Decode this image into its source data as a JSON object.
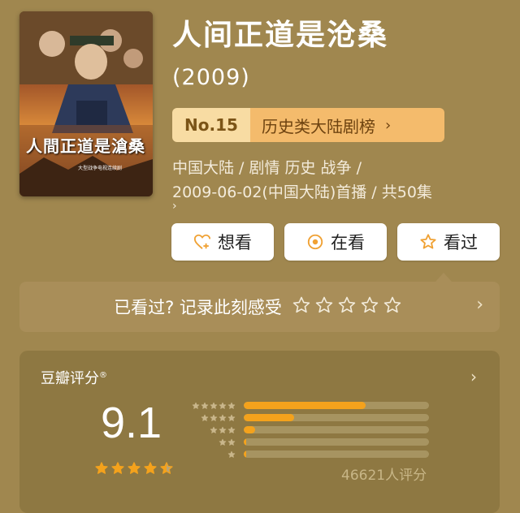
{
  "movie": {
    "title": "人间正道是沧桑",
    "year": "(2009)",
    "poster_title": "人間正道是滄桑",
    "poster_subtitle": "大型战争电视连续剧"
  },
  "rank": {
    "number": "No.15",
    "list_name": "历史类大陆剧榜"
  },
  "meta": {
    "line1": "中国大陆 / 剧情 历史 战争 /",
    "line2": "2009-06-02(中国大陆)首播 / 共50集"
  },
  "actions": {
    "want": "想看",
    "watching": "在看",
    "watched": "看过"
  },
  "record": {
    "prompt": "已看过? 记录此刻感受"
  },
  "rating": {
    "title": "豆瓣评分",
    "score": "9.1",
    "score_stars": 4.5,
    "distribution": [
      0.66,
      0.27,
      0.06,
      0.01,
      0.01
    ],
    "count": "46621人评分"
  },
  "colors": {
    "accent": "#F4A21C",
    "background": "#A0874F",
    "card": "#8E7842"
  },
  "icons": [
    "heart-plus-icon",
    "circle-dot-icon",
    "star-icon",
    "chevron-right-icon"
  ]
}
